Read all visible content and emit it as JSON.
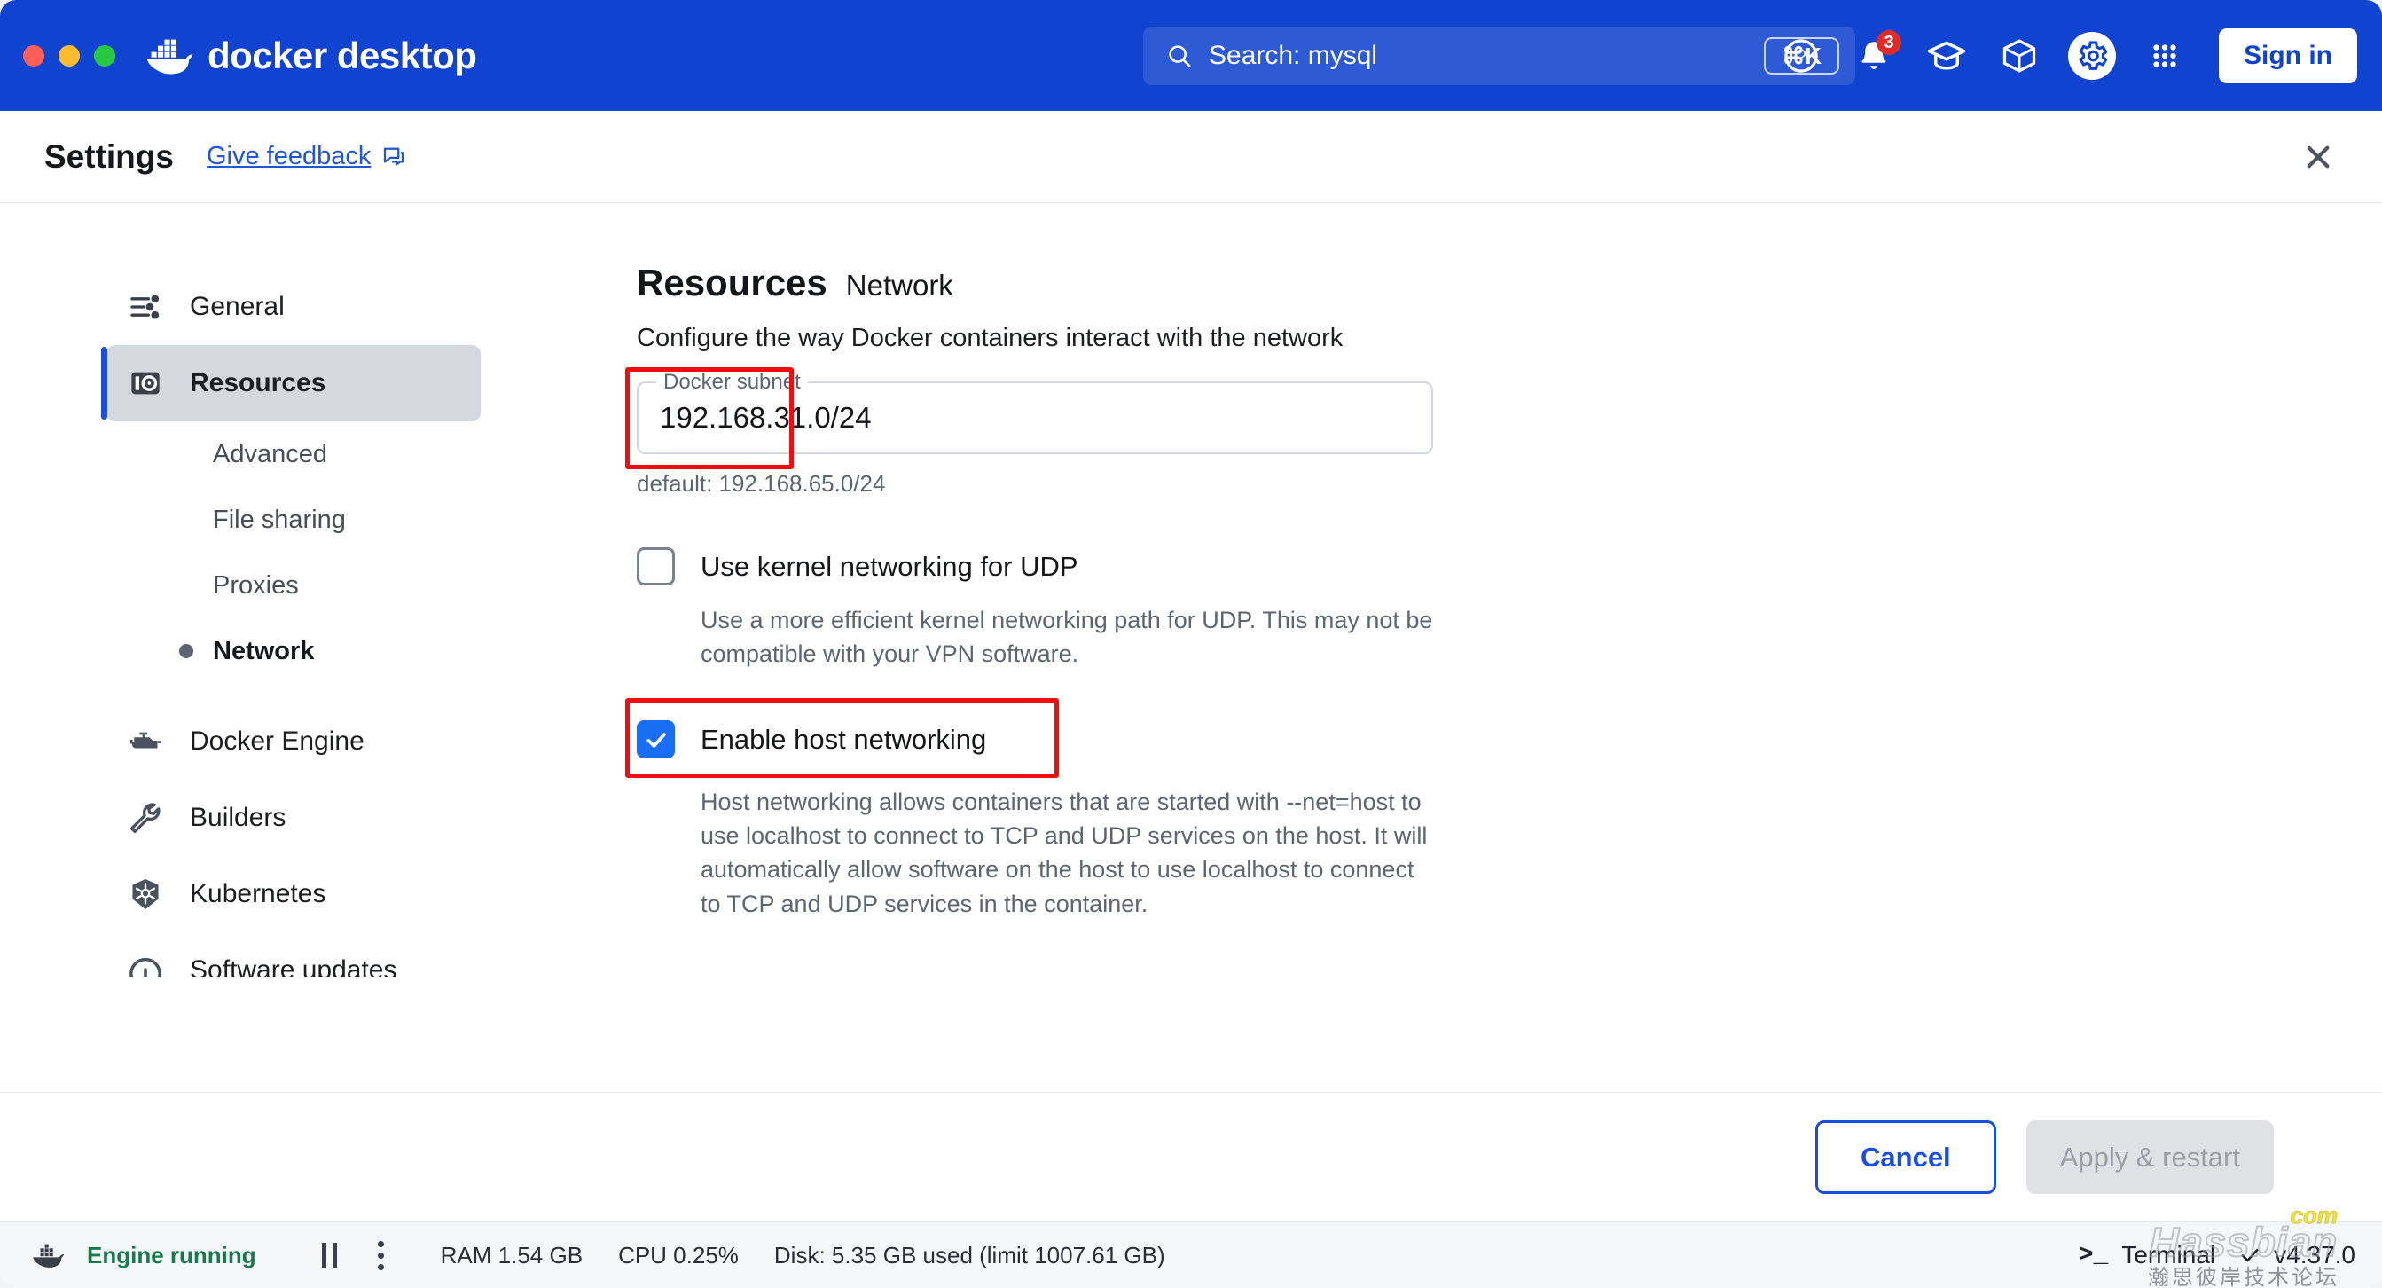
{
  "titlebar": {
    "brand": "docker desktop",
    "brand_icon": "docker-whale-icon",
    "search": {
      "text": "Search: mysql",
      "icon": "search-icon",
      "shortcut": "⌘K"
    },
    "icons": [
      {
        "name": "help-icon",
        "label": "?"
      },
      {
        "name": "notifications-bell-icon",
        "badge": "3"
      },
      {
        "name": "learning-center-cap-icon"
      },
      {
        "name": "extensions-box-icon"
      },
      {
        "name": "settings-gear-icon"
      },
      {
        "name": "apps-grid-icon"
      }
    ],
    "sign_in": "Sign in"
  },
  "settings_header": {
    "title": "Settings",
    "feedback_label": "Give feedback",
    "feedback_icon": "feedback-bubble-icon",
    "close_icon": "close-icon"
  },
  "sidebar": {
    "items": [
      {
        "label": "General",
        "icon": "sliders-icon",
        "selected": false
      },
      {
        "label": "Resources",
        "icon": "resources-icon",
        "selected": true
      },
      {
        "label": "Docker Engine",
        "icon": "engine-icon",
        "selected": false
      },
      {
        "label": "Builders",
        "icon": "wrench-icon",
        "selected": false
      },
      {
        "label": "Kubernetes",
        "icon": "kubernetes-helm-icon",
        "selected": false
      },
      {
        "label": "Software updates",
        "icon": "gauge-icon",
        "selected": false
      }
    ],
    "sub_items": [
      {
        "label": "Advanced",
        "active": false
      },
      {
        "label": "File sharing",
        "active": false
      },
      {
        "label": "Proxies",
        "active": false
      },
      {
        "label": "Network",
        "active": true
      }
    ]
  },
  "main": {
    "breadcrumb_parent": "Resources",
    "breadcrumb_current": "Network",
    "subtitle": "Configure the way Docker containers interact with the network",
    "subnet": {
      "legend": "Docker subnet",
      "value": "192.168.31.0/24",
      "help": "default: 192.168.65.0/24"
    },
    "options": [
      {
        "label": "Use kernel networking for UDP",
        "checked": false,
        "description": "Use a more efficient kernel networking path for UDP. This may not be compatible with your VPN software."
      },
      {
        "label": "Enable host networking",
        "checked": true,
        "description": "Host networking allows containers that are started with --net=host to use localhost to connect to TCP and UDP services on the host. It will automatically allow software on the host to use localhost to connect to TCP and UDP services in the container."
      }
    ]
  },
  "footer": {
    "cancel_label": "Cancel",
    "apply_label": "Apply & restart"
  },
  "statusbar": {
    "engine_status": "Engine running",
    "ram": "RAM 1.54 GB",
    "cpu": "CPU 0.25%",
    "disk": "Disk: 5.35 GB used (limit 1007.61 GB)",
    "terminal_label": "Terminal",
    "terminal_glyph": ">_",
    "version": "v4.37.0"
  },
  "watermark": {
    "main": "Hassbian",
    "tld": "com",
    "subtitle": "瀚思彼岸技术论坛"
  },
  "colors": {
    "brand_blue": "#1043cf",
    "accent_blue": "#1a4ede",
    "checkbox_blue": "#1a6ef5",
    "annotation_red": "#ef0d0d",
    "engine_green": "#177a4c"
  }
}
